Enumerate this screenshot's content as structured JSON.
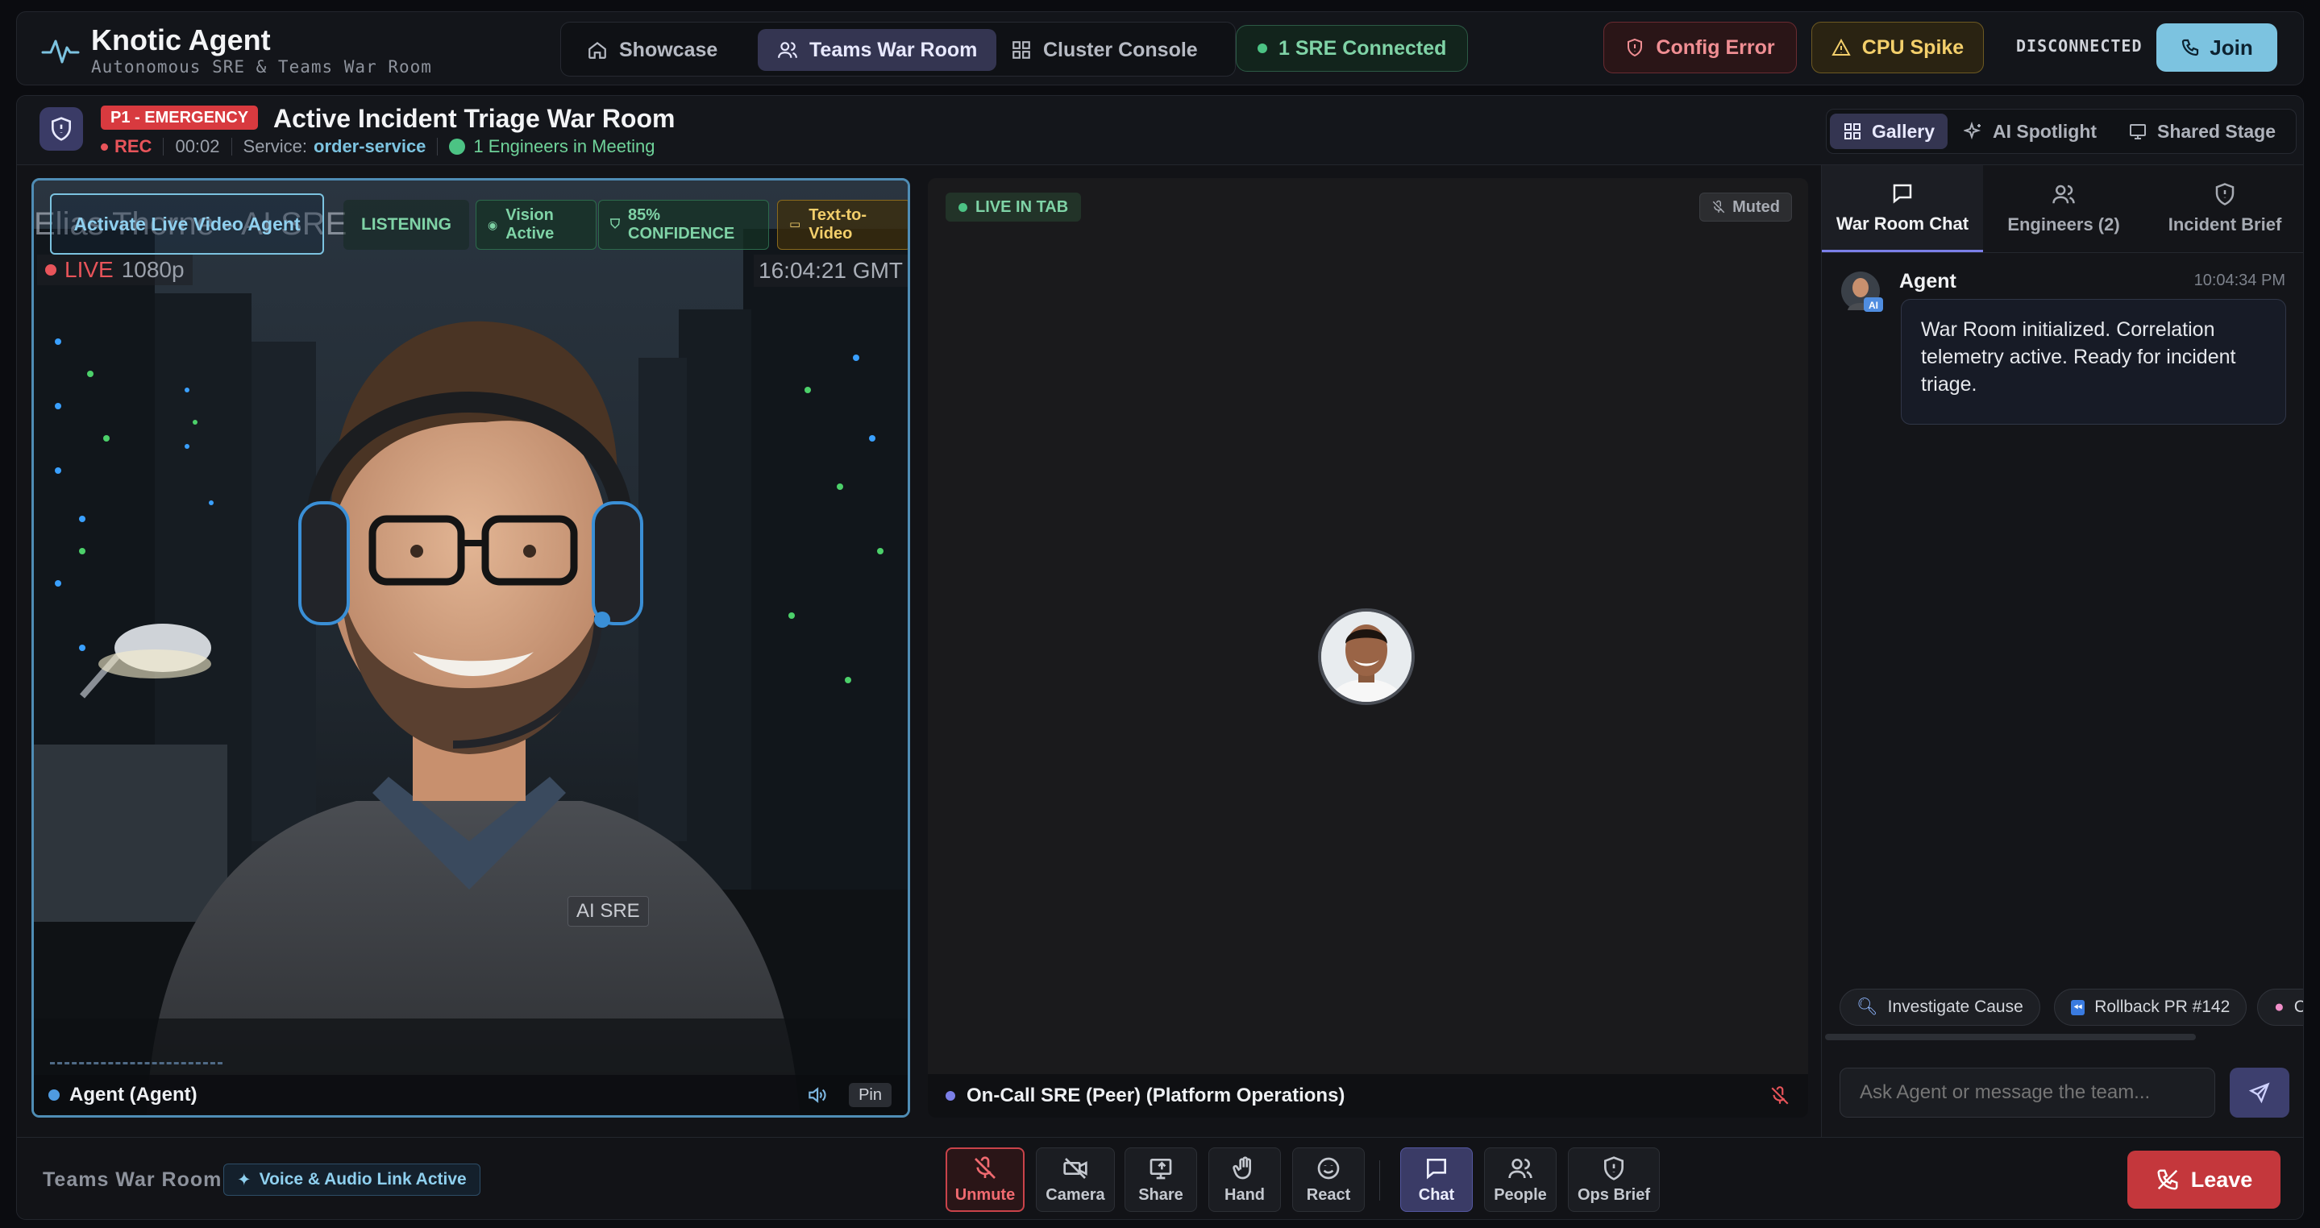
{
  "app": {
    "title": "Knotic Agent",
    "subtitle": "Autonomous SRE & Teams War Room"
  },
  "nav": {
    "items": [
      {
        "label": "Showcase",
        "icon": "home-icon"
      },
      {
        "label": "Teams War Room",
        "icon": "users-icon",
        "active": true
      },
      {
        "label": "Cluster Console",
        "icon": "grid-icon"
      }
    ],
    "sre_connected": "1 SRE Connected"
  },
  "alerts": {
    "config_error": "Config Error",
    "cpu_spike": "CPU Spike"
  },
  "connection_status": "DISCONNECTED",
  "join_label": "Join",
  "incident": {
    "severity": "P1 - EMERGENCY",
    "title": "Active Incident Triage War Room",
    "rec": "REC",
    "timer": "00:02",
    "service_label": "Service:",
    "service_value": "order-service",
    "engineers": "1 Engineers in Meeting"
  },
  "views": [
    {
      "label": "Gallery",
      "icon": "grid-icon",
      "active": true
    },
    {
      "label": "AI Spotlight",
      "icon": "sparkle-icon"
    },
    {
      "label": "Shared Stage",
      "icon": "screen-share-icon"
    }
  ],
  "agent_tile": {
    "activate_button": "Activate Live Video Agent",
    "ghost_name": "Elias Thorne - AI SRE",
    "status_listening": "LISTENING",
    "vision": "Vision Active",
    "confidence": "85% CONFIDENCE",
    "text_to_video": "Text-to-Video",
    "live": "LIVE",
    "resolution": "1080p",
    "timestamp": "16:04:21 GMT",
    "shirt_tag": "AI SRE",
    "name": "Agent (Agent)",
    "pin": "Pin"
  },
  "peer_tile": {
    "live_in_tab": "LIVE IN TAB",
    "muted": "Muted",
    "name": "On-Call SRE (Peer) (Platform Operations)"
  },
  "sidebar": {
    "tabs": [
      {
        "label": "War Room Chat",
        "icon": "chat-icon",
        "active": true
      },
      {
        "label": "Engineers (2)",
        "icon": "users-icon"
      },
      {
        "label": "Incident Brief",
        "icon": "shield-icon"
      }
    ],
    "messages": [
      {
        "sender": "Agent",
        "badge": "AI",
        "time": "10:04:34 PM",
        "text": "War Room initialized. Correlation telemetry active. Ready for incident triage."
      }
    ],
    "quick_actions": [
      "Investigate Cause",
      "Rollback PR #142",
      "Ch"
    ],
    "input_placeholder": "Ask Agent or message the team..."
  },
  "bottom": {
    "title": "Teams War Room",
    "voice_status": "Voice & Audio Link Active",
    "controls": [
      "Unmute",
      "Camera",
      "Share",
      "Hand",
      "React",
      "Chat",
      "People",
      "Ops Brief"
    ],
    "leave": "Leave"
  },
  "colors": {
    "accent": "#7cc3e0",
    "active_nav": "#343551",
    "danger": "#c4373c",
    "success": "#7fd3a6",
    "warning": "#f3cf6b"
  }
}
